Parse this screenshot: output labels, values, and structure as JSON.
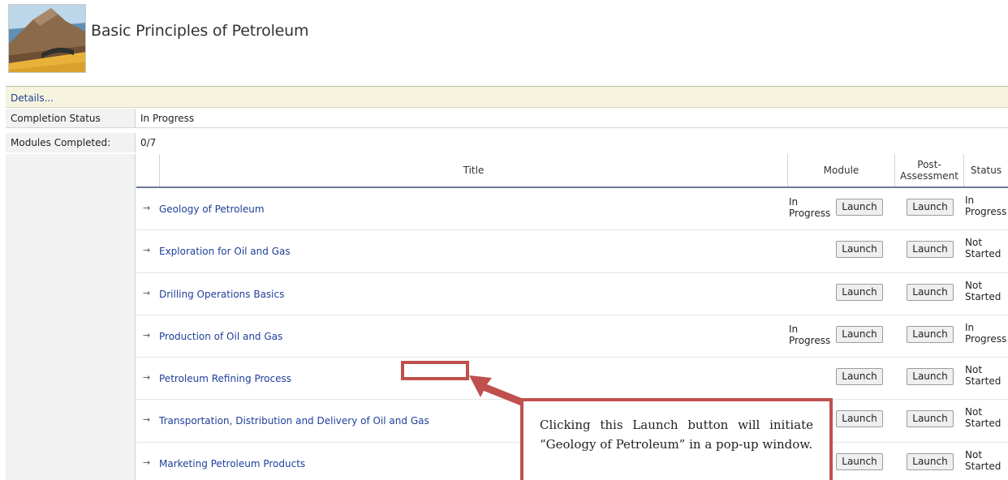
{
  "course": {
    "logo_icon": "petroleum-geology-cross-section-icon",
    "title": "Basic Principles of Petroleum"
  },
  "details": {
    "label": "Details..."
  },
  "info": {
    "completion_status_label": "Completion Status",
    "completion_status_value": "In Progress",
    "modules_completed_label": "Modules Completed:",
    "modules_completed_value": "0/7"
  },
  "table": {
    "headers": {
      "title": "Title",
      "module": "Module",
      "post_assessment": "Post-\nAssessment",
      "status": "Status"
    },
    "arrow_glyph": "→",
    "launch_label": "Launch",
    "rows": [
      {
        "title": "Geology of Petroleum",
        "module_state": "In\nProgress",
        "status": "In\nProgress"
      },
      {
        "title": "Exploration for Oil and Gas",
        "module_state": "",
        "status": "Not\nStarted"
      },
      {
        "title": "Drilling Operations Basics",
        "module_state": "",
        "status": "Not\nStarted"
      },
      {
        "title": "Production of Oil and Gas",
        "module_state": "In\nProgress",
        "status": "In\nProgress"
      },
      {
        "title": "Petroleum Refining Process",
        "module_state": "",
        "status": "Not\nStarted"
      },
      {
        "title": "Transportation, Distribution and Delivery of Oil and Gas",
        "module_state": "",
        "status": "Not\nStarted"
      },
      {
        "title": "Marketing Petroleum Products",
        "module_state": "",
        "status": "Not\nStarted"
      }
    ]
  },
  "callout": {
    "text": "Clicking this Launch button will initiate “Geology of Petroleum” in a pop-up window.",
    "border_color": "#c0504d"
  },
  "colors": {
    "link": "#1f3f99",
    "details_bar": "#f6f4de",
    "annotation": "#c0504d"
  }
}
